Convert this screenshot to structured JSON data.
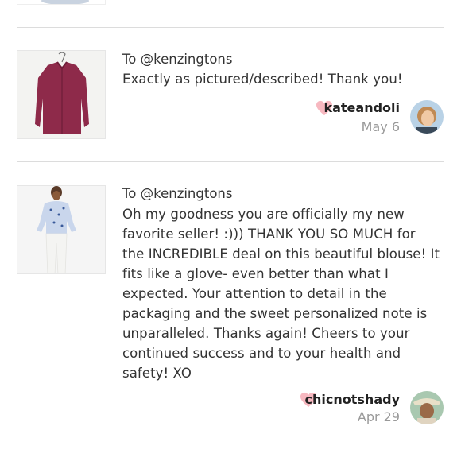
{
  "reviews": [
    {
      "to": "To @kenzingtons",
      "message": "Exactly as pictured/described! Thank you!",
      "username": "kateandoli",
      "date": "May 6",
      "heart_color": "#f7b8c0"
    },
    {
      "to": "To @kenzingtons",
      "message": "Oh my goodness you are officially my new favorite seller! :))) THANK YOU SO MUCH for the INCREDIBLE deal on this beautiful blouse! It fits like a glove- even better than what I expected. Your attention to detail in the packaging and the sweet personalized note is unparalleled. Thanks again! Cheers to your continued success and to your health and safety! XO",
      "username": "chicnotshady",
      "date": "Apr 29",
      "heart_color": "#f7b8c0"
    }
  ]
}
